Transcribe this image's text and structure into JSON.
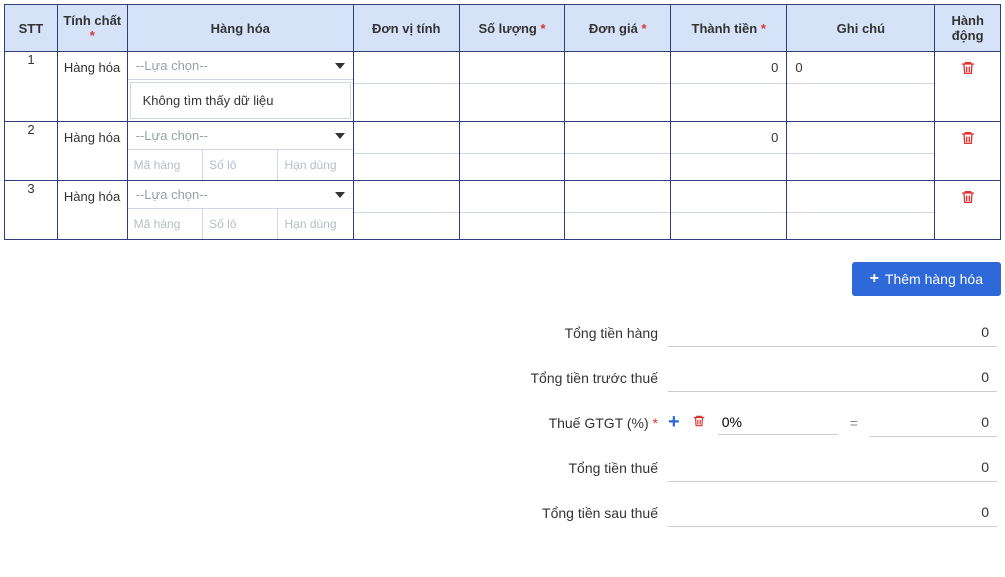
{
  "columns": {
    "stt": "STT",
    "tinhchat": "Tính chất",
    "hanghoa": "Hàng hóa",
    "dvt": "Đơn vị tính",
    "soluong": "Số lượng",
    "dongia": "Đơn giá",
    "thanhtien": "Thành tiền",
    "ghichu": "Ghi chú",
    "hanhdong": "Hành động"
  },
  "placeholders": {
    "luachon": "--Lựa chọn--",
    "mahang": "Mã hàng",
    "solo": "Số lô",
    "handung": "Hạn dùng"
  },
  "dropdown_empty": "Không tìm thấy dữ liệu",
  "rows": [
    {
      "stt": "1",
      "tinhchat": "Hàng hóa",
      "dropdown_open": true,
      "thanhtien": "0",
      "ghichu": "0"
    },
    {
      "stt": "2",
      "tinhchat": "Hàng hóa",
      "dropdown_open": false,
      "thanhtien": "0",
      "ghichu": ""
    },
    {
      "stt": "3",
      "tinhchat": "Hàng hóa",
      "dropdown_open": false,
      "thanhtien": "",
      "ghichu": ""
    }
  ],
  "add_button": "Thêm hàng hóa",
  "totals": {
    "tong_tien_hang": {
      "label": "Tổng tiền hàng",
      "value": "0"
    },
    "tong_tien_truoc_thue": {
      "label": "Tổng tiền trước thuế",
      "value": "0"
    },
    "thue_gtgt": {
      "label": "Thuế GTGT (%)",
      "pct": "0%",
      "value": "0"
    },
    "tong_tien_thue": {
      "label": "Tổng tiền thuế",
      "value": "0"
    },
    "tong_tien_sau_thue": {
      "label": "Tổng tiền sau thuế",
      "value": "0"
    }
  }
}
